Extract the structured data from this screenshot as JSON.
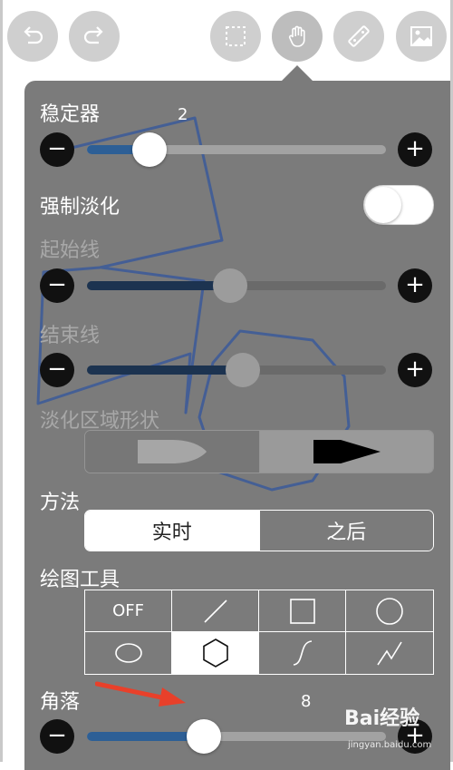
{
  "toolbar": {
    "undo_icon": "undo-icon",
    "redo_icon": "redo-icon",
    "select_icon": "selection-icon",
    "hand_icon": "hand-tool-icon",
    "ruler_icon": "ruler-icon",
    "image_icon": "image-icon"
  },
  "stabilizer": {
    "label": "稳定器",
    "value": "2",
    "level": 0.21,
    "minus": "−",
    "plus": "+"
  },
  "force_fade": {
    "label": "强制淡化",
    "enabled": false
  },
  "start_line": {
    "label": "起始线",
    "level": 0.48,
    "minus": "−",
    "plus": "+"
  },
  "end_line": {
    "label": "结束线",
    "level": 0.52,
    "minus": "−",
    "plus": "+"
  },
  "fade_shape": {
    "label": "淡化区域形状",
    "options": [
      "rounded-taper-icon",
      "pointed-taper-icon"
    ],
    "selected": 1
  },
  "method": {
    "label": "方法",
    "options": [
      "实时",
      "之后"
    ],
    "selected": 0
  },
  "drawing_tools": {
    "label": "绘图工具",
    "off_label": "OFF",
    "tools": [
      "off",
      "line-icon",
      "rectangle-icon",
      "circle-icon",
      "ellipse-icon",
      "hexagon-icon",
      "curve-icon",
      "polyline-icon"
    ],
    "selected": 5
  },
  "corners": {
    "label": "角落",
    "value": "8",
    "level": 0.39,
    "minus": "−",
    "plus": "+"
  },
  "watermark": {
    "text": "Bai经验",
    "sub": "jingyan.baidu.com"
  },
  "colors": {
    "panel": "#7b7b7b",
    "slider_fill": "#2d5f96",
    "annotation_arrow": "#e8402a",
    "stroke": "#3b5a9a"
  }
}
